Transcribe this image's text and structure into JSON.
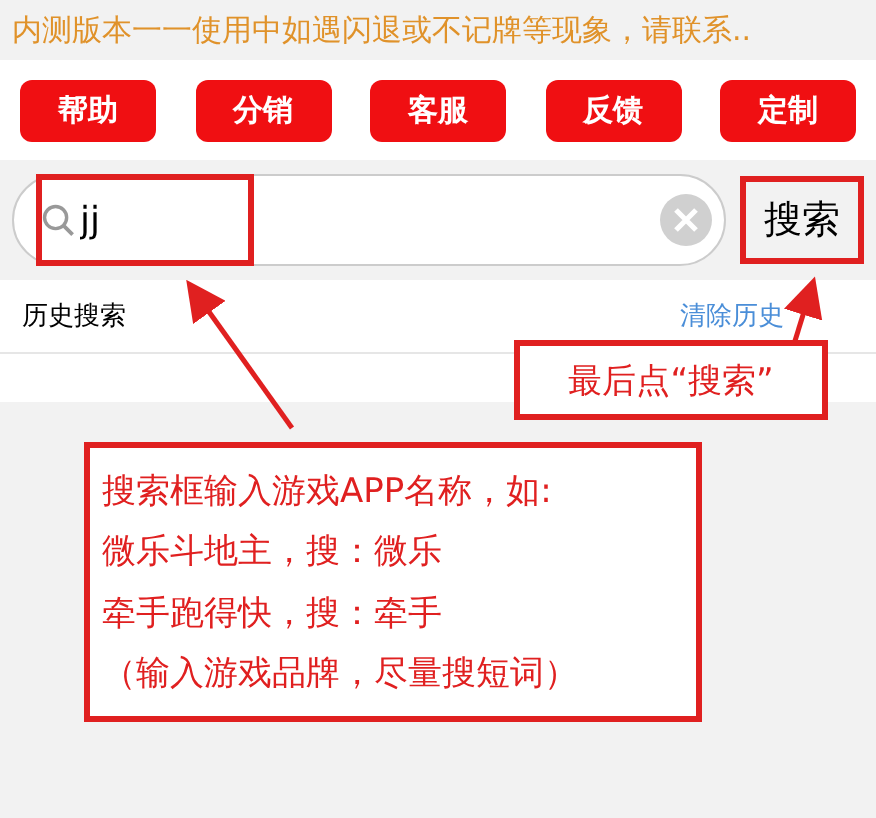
{
  "notice": "内测版本一一使用中如遇闪退或不记牌等现象，请联系..",
  "buttons": [
    "帮助",
    "分销",
    "客服",
    "反馈",
    "定制"
  ],
  "search": {
    "value": "jj"
  },
  "search_button": "搜索",
  "history": {
    "title": "历史搜索",
    "clear": "清除历史"
  },
  "annotations": {
    "callout": "最后点“搜索”",
    "note_lines": [
      "搜索框输入游戏APP名称，如:",
      "微乐斗地主，搜：微乐",
      "牵手跑得快，搜：牵手",
      "（输入游戏品牌，尽量搜短词）"
    ]
  }
}
